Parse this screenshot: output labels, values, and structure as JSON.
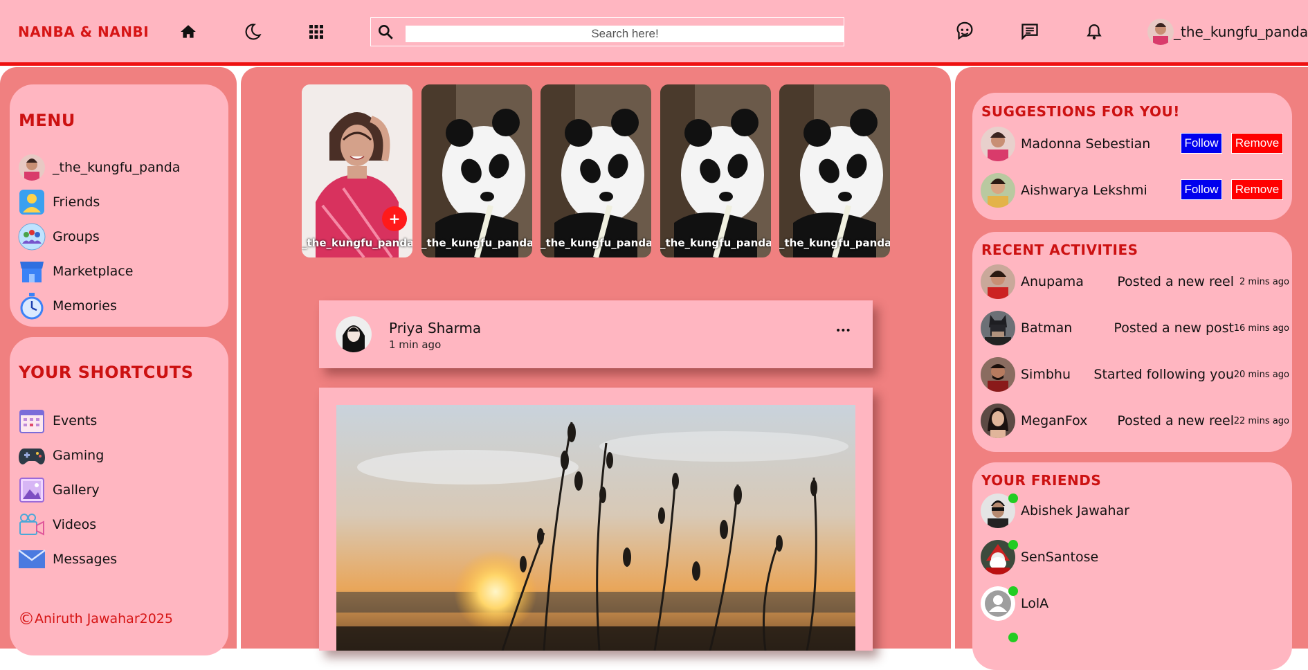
{
  "header": {
    "brand": "NANBA & NANBI",
    "search_placeholder": "Search here!",
    "username": "_the_kungfu_panda",
    "icons": [
      "home-icon",
      "moon-icon",
      "apps-grid-icon",
      "search-icon",
      "chat-bot-icon",
      "message-icon",
      "bell-icon"
    ]
  },
  "menu": {
    "title": "MENU",
    "items": [
      {
        "label": "_the_kungfu_panda",
        "icon": "profile-avatar"
      },
      {
        "label": "Friends",
        "icon": "friends-icon"
      },
      {
        "label": "Groups",
        "icon": "groups-icon"
      },
      {
        "label": "Marketplace",
        "icon": "marketplace-icon"
      },
      {
        "label": "Memories",
        "icon": "memories-icon"
      }
    ]
  },
  "shortcuts": {
    "title": "YOUR SHORTCUTS",
    "items": [
      {
        "label": "Events",
        "icon": "calendar-icon"
      },
      {
        "label": "Gaming",
        "icon": "gamepad-icon"
      },
      {
        "label": "Gallery",
        "icon": "gallery-icon"
      },
      {
        "label": "Videos",
        "icon": "video-icon"
      },
      {
        "label": "Messages",
        "icon": "mail-icon"
      }
    ],
    "copyright_symbol": "©",
    "copyright": "Aniruth Jawahar2025"
  },
  "stories": [
    {
      "name": "_the_kungfu_panda",
      "own": true
    },
    {
      "name": "_the_kungfu_panda"
    },
    {
      "name": "_the_kungfu_panda"
    },
    {
      "name": "_the_kungfu_panda"
    },
    {
      "name": "_the_kungfu_panda"
    }
  ],
  "post": {
    "author": "Priya Sharma",
    "time": "1 min ago",
    "more": "•••"
  },
  "suggestions": {
    "title": "SUGGESTIONS FOR YOU!",
    "follow_label": "Follow",
    "remove_label": "Remove",
    "people": [
      {
        "name": "Madonna Sebestian"
      },
      {
        "name": "Aishwarya Lekshmi"
      }
    ]
  },
  "activities": {
    "title": "RECENT ACTIVITIES",
    "items": [
      {
        "name": "Anupama",
        "action": "Posted a new reel",
        "time": "2 mins ago"
      },
      {
        "name": "Batman",
        "action": "Posted a new post",
        "time": "16 mins ago"
      },
      {
        "name": "Simbhu",
        "action": "Started following you",
        "time": "20 mins ago"
      },
      {
        "name": "MeganFox",
        "action": "Posted a new reel",
        "time": "22 mins ago"
      }
    ]
  },
  "friends": {
    "title": "YOUR FRIENDS",
    "items": [
      {
        "name": "Abishek Jawahar"
      },
      {
        "name": "SenSantose"
      },
      {
        "name": "LolA"
      }
    ]
  },
  "colors": {
    "accent": "#ffb6c1",
    "panel": "#f08080",
    "brand": "#d61515",
    "follow": "#0000ee",
    "remove": "#ff0000",
    "online": "#22cc22"
  }
}
